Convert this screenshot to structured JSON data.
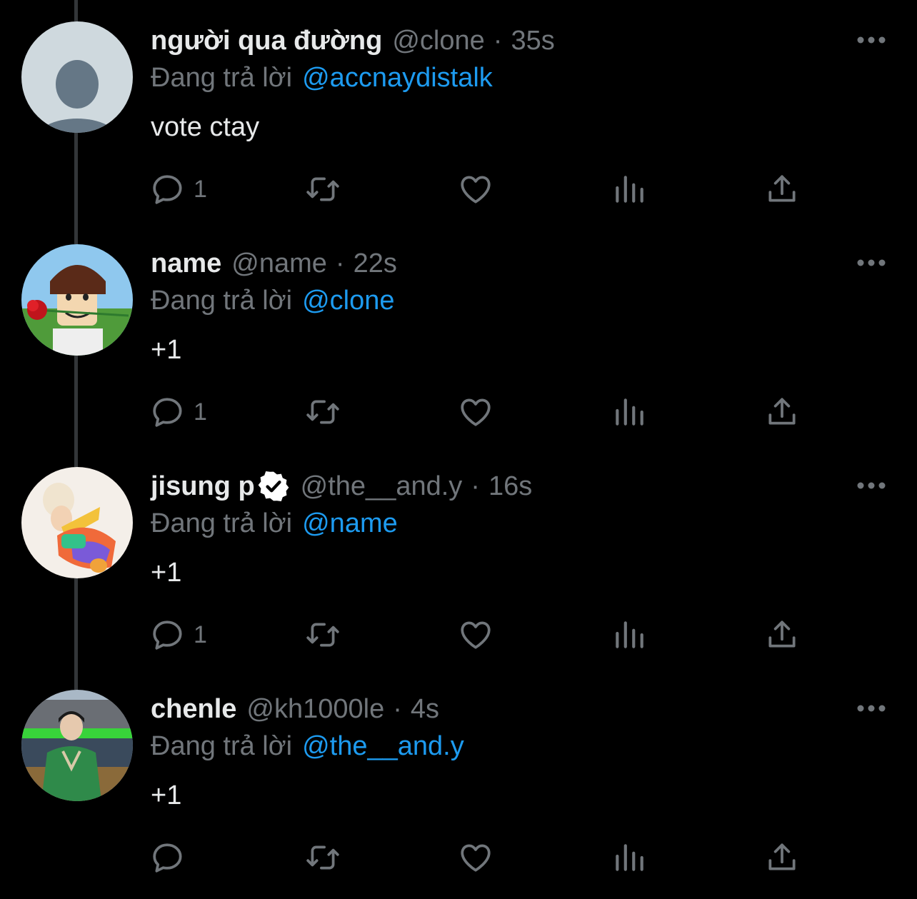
{
  "colors": {
    "background": "#000000",
    "primary_text": "#e7e9ea",
    "secondary_text": "#71767b",
    "link": "#1d9bf0",
    "thread_line": "#333639"
  },
  "tweets": [
    {
      "display_name": "người qua đường",
      "handle": "@clone",
      "separator": "·",
      "time": "35s",
      "verified": false,
      "replying_prefix": "Đang trả lời",
      "replying_to": "@accnaydistalk",
      "text": "vote ctay",
      "reply_count": "1",
      "avatar": "default-avatar"
    },
    {
      "display_name": "name",
      "handle": "@name",
      "separator": "·",
      "time": "22s",
      "verified": false,
      "replying_prefix": "Đang trả lời",
      "replying_to": "@clone",
      "text": "+1",
      "reply_count": "1",
      "avatar": "roblox-character-with-rose"
    },
    {
      "display_name": "jisung p",
      "handle": "@the__and.y",
      "separator": "·",
      "time": "16s",
      "verified": true,
      "replying_prefix": "Đang trả lời",
      "replying_to": "@name",
      "text": "+1",
      "reply_count": "1",
      "avatar": "person-in-colorful-sweater"
    },
    {
      "display_name": "chenle",
      "handle": "@kh1000le",
      "separator": "·",
      "time": "4s",
      "verified": false,
      "replying_prefix": "Đang trả lời",
      "replying_to": "@the__and.y",
      "text": "+1",
      "reply_count": "",
      "avatar": "person-in-green-sweater-by-river"
    }
  ],
  "icons": {
    "reply": "reply-icon",
    "retweet": "retweet-icon",
    "like": "like-icon",
    "views": "views-icon",
    "share": "share-icon",
    "more": "more-icon",
    "verified": "verified-badge-icon"
  }
}
